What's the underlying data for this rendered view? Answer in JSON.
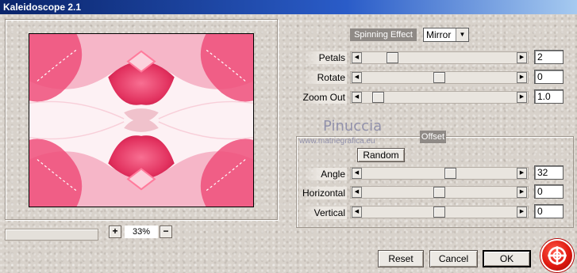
{
  "window": {
    "title": "Kaleidoscope 2.1"
  },
  "preview": {
    "zoom_in": "+",
    "zoom_out": "−",
    "zoom_value": "33%"
  },
  "effect": {
    "label": "Spinning Effect",
    "mode": "Mirror",
    "rows": [
      {
        "label": "Petals",
        "value": "2",
        "fraction": 0.17
      },
      {
        "label": "Rotate",
        "value": "0",
        "fraction": 0.5
      },
      {
        "label": "Zoom Out",
        "value": "1.0",
        "fraction": 0.07
      }
    ]
  },
  "watermark": {
    "name": "Pinuccia",
    "site": "www.matriegrafica.eu"
  },
  "offset": {
    "label": "Offset",
    "random_label": "Random",
    "rows": [
      {
        "label": "Angle",
        "value": "32",
        "fraction": 0.58
      },
      {
        "label": "Horizontal",
        "value": "0",
        "fraction": 0.5
      },
      {
        "label": "Vertical",
        "value": "0",
        "fraction": 0.5
      }
    ]
  },
  "buttons": {
    "reset": "Reset",
    "cancel": "Cancel",
    "ok": "OK"
  },
  "colors": {
    "title_bar": "#0a246a",
    "preview_pink": "#ef3a6a",
    "logo_red": "#e01a10"
  },
  "icons": {
    "logo": "help-lifebuoy-icon",
    "slider_left": "arrow-left-icon",
    "slider_right": "arrow-right-icon",
    "select": "chevron-down-icon"
  }
}
